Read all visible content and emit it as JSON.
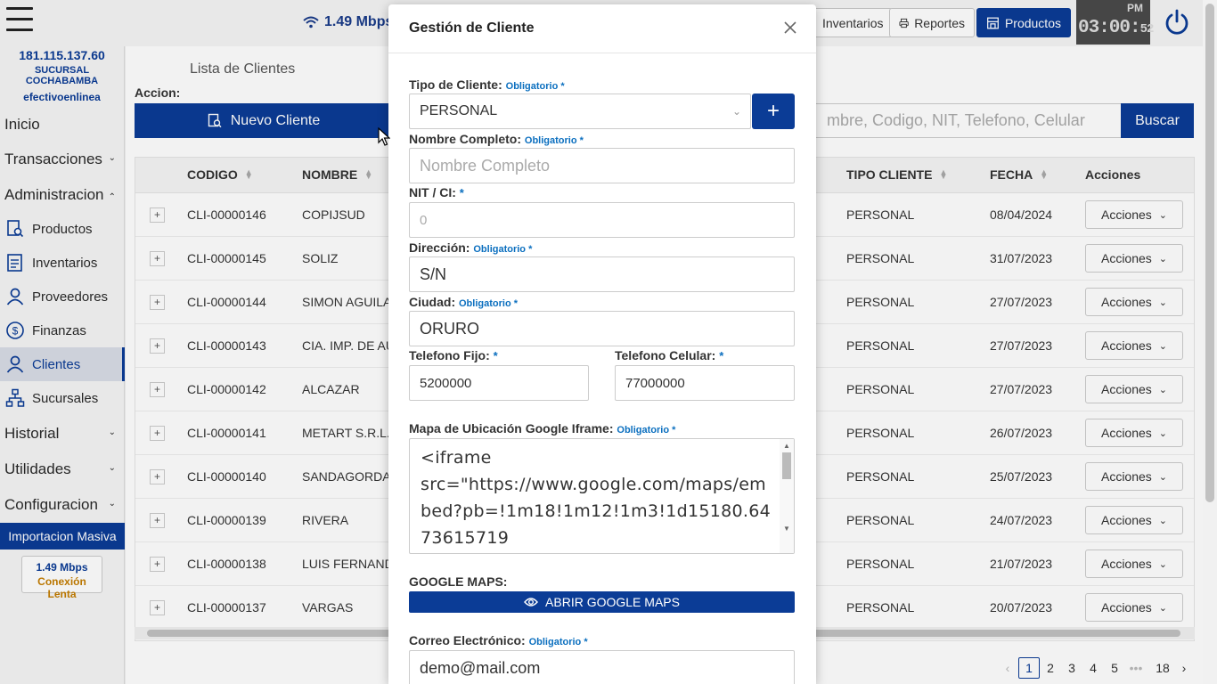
{
  "topbar": {
    "speed": "1.49 Mbps",
    "buttons": [
      {
        "label": "Inventarios",
        "icon": "clipboard-icon"
      },
      {
        "label": "Reportes",
        "icon": "printer-icon"
      },
      {
        "label": "Productos",
        "icon": "store-icon"
      }
    ],
    "clock": {
      "ampm": "PM",
      "time": "03:00:",
      "seconds": "52"
    }
  },
  "sidebar": {
    "ip": "181.115.137.60",
    "branch": "SUCURSAL COCHABAMBA",
    "user": "efectivoenlinea",
    "items": [
      {
        "label": "Inicio"
      },
      {
        "label": "Transacciones"
      },
      {
        "label": "Administracion"
      },
      {
        "label": "Productos"
      },
      {
        "label": "Inventarios"
      },
      {
        "label": "Proveedores"
      },
      {
        "label": "Finanzas"
      },
      {
        "label": "Clientes"
      },
      {
        "label": "Sucursales"
      },
      {
        "label": "Historial"
      },
      {
        "label": "Utilidades"
      },
      {
        "label": "Configuracion"
      }
    ],
    "import_label": "Importacion Masiva",
    "conn_speed": "1.49 Mbps",
    "conn_status": "Conexión Lenta"
  },
  "main": {
    "title": "Lista de Clientes",
    "accion_label": "Accion:",
    "new_button": "Nuevo Cliente",
    "search_placeholder": "mbre, Codigo, NIT, Telefono, Celular",
    "search_button": "Buscar",
    "columns": {
      "codigo": "CODIGO",
      "nombre": "NOMBRE",
      "tipo": "TIPO CLIENTE",
      "fecha": "FECHA",
      "acciones": "Acciones"
    },
    "rows": [
      {
        "codigo": "CLI-00000146",
        "nombre": "COPIJSUD",
        "tipo": "PERSONAL",
        "fecha": "08/04/2024"
      },
      {
        "codigo": "CLI-00000145",
        "nombre": "SOLIZ",
        "tipo": "PERSONAL",
        "fecha": "31/07/2023"
      },
      {
        "codigo": "CLI-00000144",
        "nombre": "SIMON AGUILAR",
        "tipo": "PERSONAL",
        "fecha": "27/07/2023"
      },
      {
        "codigo": "CLI-00000143",
        "nombre": "CIA. IMP. DE AU",
        "tipo": "PERSONAL",
        "fecha": "27/07/2023"
      },
      {
        "codigo": "CLI-00000142",
        "nombre": "ALCAZAR",
        "tipo": "PERSONAL",
        "fecha": "27/07/2023"
      },
      {
        "codigo": "CLI-00000141",
        "nombre": "METART S.R.L.",
        "tipo": "PERSONAL",
        "fecha": "26/07/2023"
      },
      {
        "codigo": "CLI-00000140",
        "nombre": "SANDAGORDA",
        "tipo": "PERSONAL",
        "fecha": "25/07/2023"
      },
      {
        "codigo": "CLI-00000139",
        "nombre": "RIVERA",
        "tipo": "PERSONAL",
        "fecha": "24/07/2023"
      },
      {
        "codigo": "CLI-00000138",
        "nombre": "LUIS FERNANDO",
        "tipo": "PERSONAL",
        "fecha": "21/07/2023"
      },
      {
        "codigo": "CLI-00000137",
        "nombre": "VARGAS",
        "tipo": "PERSONAL",
        "fecha": "20/07/2023"
      }
    ],
    "row_action": "Acciones",
    "pagination": [
      "1",
      "2",
      "3",
      "4",
      "5",
      "•••",
      "18"
    ]
  },
  "modal": {
    "title": "Gestión de Cliente",
    "required": "Obligatorio *",
    "star": "*",
    "tipo_label": "Tipo de Cliente:",
    "tipo_value": "PERSONAL",
    "nombre_label": "Nombre Completo:",
    "nombre_placeholder": "Nombre Completo",
    "nit_label": "NIT / CI:",
    "nit_placeholder": "0",
    "direccion_label": "Dirección:",
    "direccion_value": "S/N",
    "ciudad_label": "Ciudad:",
    "ciudad_value": "ORURO",
    "tel_fijo_label": "Telefono Fijo:",
    "tel_fijo_value": "5200000",
    "tel_cel_label": "Telefono Celular:",
    "tel_cel_value": "77000000",
    "mapa_label": "Mapa de Ubicación Google Iframe:",
    "mapa_value": "<iframe\nsrc=\"https://www.google.com/maps/embed?pb=!1m18!1m12!1m3!1d15180.6473615719",
    "gmaps_label": "GOOGLE MAPS:",
    "gmaps_button": "ABRIR GOOGLE MAPS",
    "correo_label": "Correo Electrónico:",
    "correo_value": "demo@mail.com"
  },
  "colors": {
    "primary": "#0b3c96",
    "required": "#0b6fbf",
    "warning": "#c47d00"
  }
}
